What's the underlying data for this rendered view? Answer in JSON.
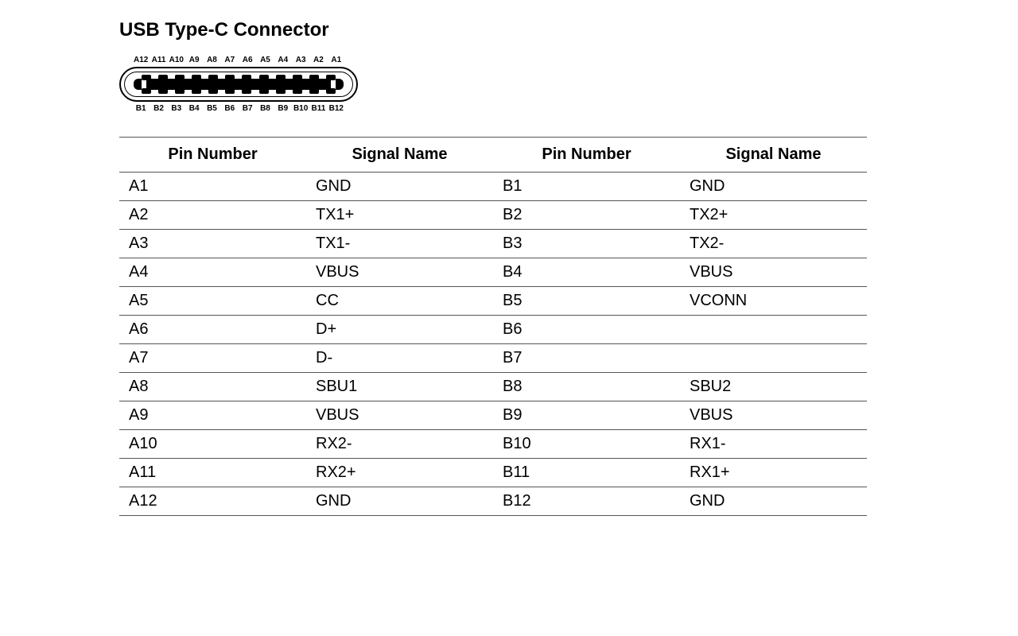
{
  "title": "USB Type-C Connector",
  "connector": {
    "top_pins": [
      "A12",
      "A11",
      "A10",
      "A9",
      "A8",
      "A7",
      "A6",
      "A5",
      "A4",
      "A3",
      "A2",
      "A1"
    ],
    "bottom_pins": [
      "B1",
      "B2",
      "B3",
      "B4",
      "B5",
      "B6",
      "B7",
      "B8",
      "B9",
      "B10",
      "B11",
      "B12"
    ]
  },
  "table": {
    "headers": [
      "Pin Number",
      "Signal Name",
      "Pin Number",
      "Signal Name"
    ],
    "rows": [
      {
        "a_pin": "A1",
        "a_sig": "GND",
        "b_pin": "B1",
        "b_sig": "GND"
      },
      {
        "a_pin": "A2",
        "a_sig": "TX1+",
        "b_pin": "B2",
        "b_sig": "TX2+"
      },
      {
        "a_pin": "A3",
        "a_sig": "TX1-",
        "b_pin": "B3",
        "b_sig": "TX2-"
      },
      {
        "a_pin": "A4",
        "a_sig": "VBUS",
        "b_pin": "B4",
        "b_sig": "VBUS"
      },
      {
        "a_pin": "A5",
        "a_sig": "CC",
        "b_pin": "B5",
        "b_sig": "VCONN"
      },
      {
        "a_pin": "A6",
        "a_sig": "D+",
        "b_pin": "B6",
        "b_sig": ""
      },
      {
        "a_pin": "A7",
        "a_sig": "D-",
        "b_pin": "B7",
        "b_sig": ""
      },
      {
        "a_pin": "A8",
        "a_sig": "SBU1",
        "b_pin": "B8",
        "b_sig": "SBU2"
      },
      {
        "a_pin": "A9",
        "a_sig": "VBUS",
        "b_pin": "B9",
        "b_sig": "VBUS"
      },
      {
        "a_pin": "A10",
        "a_sig": "RX2-",
        "b_pin": "B10",
        "b_sig": "RX1-"
      },
      {
        "a_pin": "A11",
        "a_sig": "RX2+",
        "b_pin": "B11",
        "b_sig": "RX1+"
      },
      {
        "a_pin": "A12",
        "a_sig": "GND",
        "b_pin": "B12",
        "b_sig": "GND"
      }
    ]
  }
}
